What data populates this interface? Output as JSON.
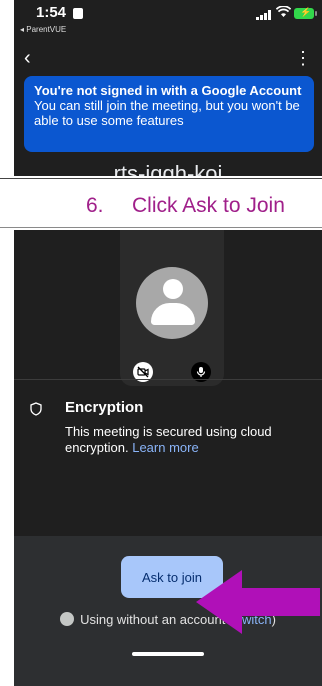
{
  "status_bar": {
    "time": "1:54",
    "back_app": "◂ ParentVUE"
  },
  "nav": {
    "back_icon": "‹",
    "more_icon": "⋮"
  },
  "banner": {
    "title": "You're not signed in with a Google Account",
    "body": "You can still join the meeting, but you won't be able to use some features"
  },
  "meeting_code": "rts-iqgh-koi",
  "instruction": {
    "number": "6.",
    "text": "Click Ask to Join"
  },
  "encryption": {
    "title": "Encryption",
    "body": "This meeting is secured using cloud encryption.",
    "link": "Learn more"
  },
  "join_button": "Ask to join",
  "account": {
    "text": "Using without an account",
    "open_paren": "(",
    "switch_link": "Switch",
    "close_paren": ")"
  },
  "colors": {
    "banner": "#0b57d0",
    "join_button": "#a8c7fa",
    "arrow": "#b010b8",
    "instruction": "#a0208a"
  }
}
